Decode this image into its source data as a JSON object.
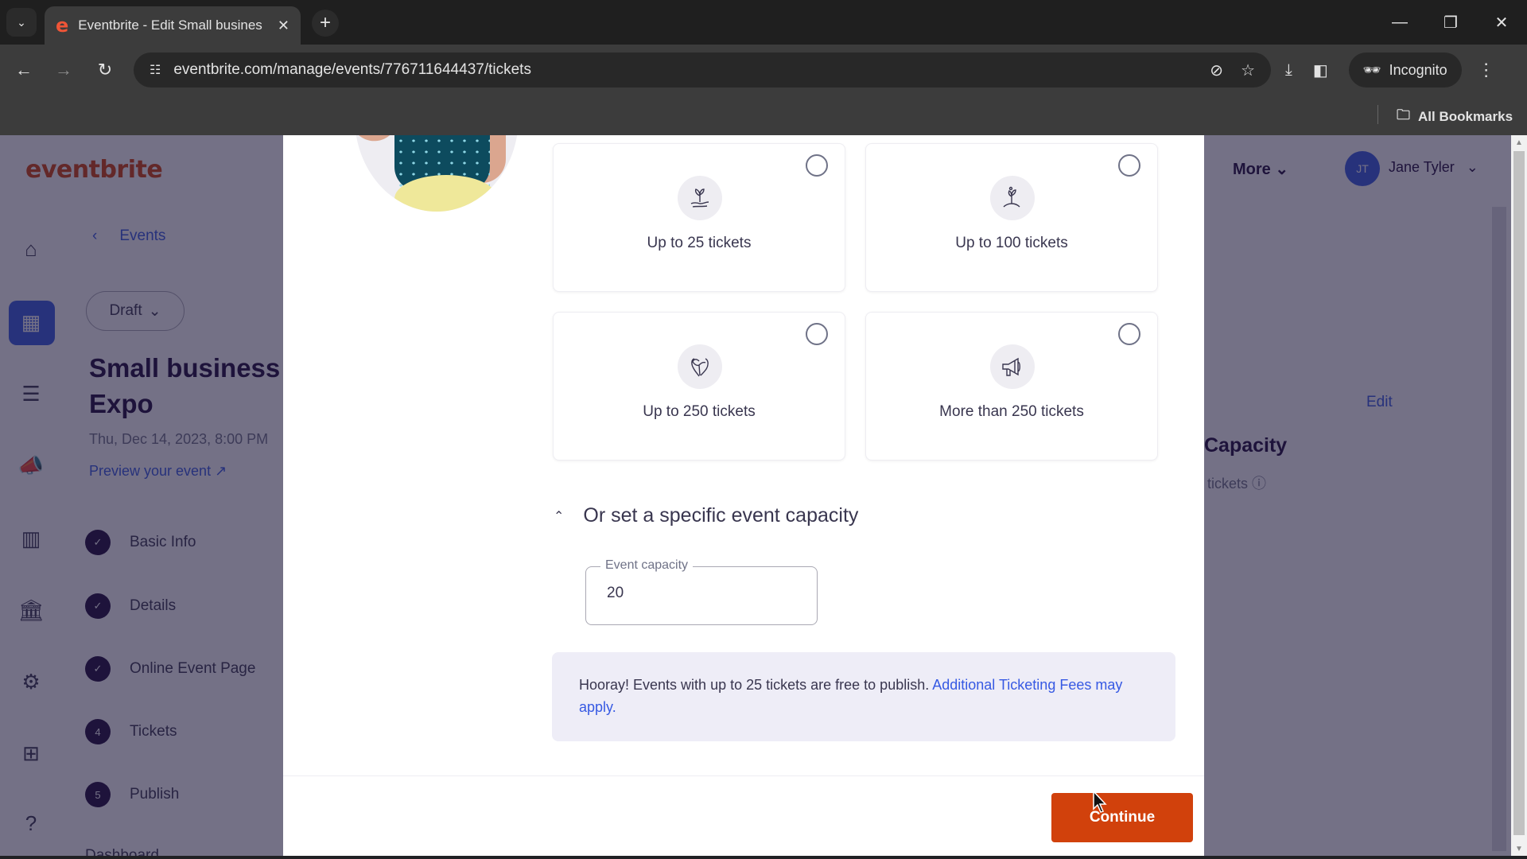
{
  "browser": {
    "tab_title": "Eventbrite - Edit Small busines",
    "favicon": "e",
    "url": "eventbrite.com/manage/events/776711644437/tickets",
    "incognito_label": "Incognito",
    "bookmarks_label": "All Bookmarks",
    "icons": {
      "tab_search": "chevron-down-icon",
      "tab_close": "close-icon",
      "new_tab": "plus-icon",
      "back": "arrow-left-icon",
      "forward": "arrow-right-icon",
      "reload": "reload-icon",
      "site_info": "tune-icon",
      "tracking": "eye-off-icon",
      "bookmark": "star-icon",
      "download": "download-icon",
      "side_panel": "side-panel-icon",
      "menu": "more-vert-icon"
    }
  },
  "page": {
    "logo": "eventbrite",
    "back_label": "Events",
    "status_button": "Draft",
    "event_title": "Small business Expo",
    "event_date": "Thu, Dec 14, 2023, 8:00 PM",
    "preview_link": "Preview your event",
    "steps": [
      {
        "label": "Basic Info",
        "state": "done",
        "marker": "✓"
      },
      {
        "label": "Details",
        "state": "done",
        "marker": "✓"
      },
      {
        "label": "Online Event Page",
        "state": "done",
        "marker": "✓"
      },
      {
        "label": "Tickets",
        "state": "current",
        "marker": "4"
      },
      {
        "label": "Publish",
        "state": "todo",
        "marker": "5"
      }
    ],
    "dashboard_label": "Dashboard",
    "top_nav_more": "More",
    "user_initials": "JT",
    "user_name": "Jane Tyler",
    "bg_edit_link": "Edit",
    "bg_capacity_heading": "Capacity",
    "bg_capacity_sub": "tickets"
  },
  "modal": {
    "options": [
      {
        "label": "Up to 25 tickets",
        "icon": "sprout-in-hand-icon",
        "selected": false
      },
      {
        "label": "Up to 100 tickets",
        "icon": "growing-plant-icon",
        "selected": false
      },
      {
        "label": "Up to 250 tickets",
        "icon": "heart-hands-icon",
        "selected": false
      },
      {
        "label": "More than 250 tickets",
        "icon": "megaphone-icon",
        "selected": false
      }
    ],
    "capacity_toggle_label": "Or set a specific event capacity",
    "capacity_field_label": "Event capacity",
    "capacity_value": "20",
    "notice_text": "Hooray! Events with up to 25 tickets are free to publish. ",
    "notice_link": "Additional Ticketing Fees may apply.",
    "continue_label": "Continue"
  },
  "colors": {
    "brand_orange": "#d1410c",
    "link_blue": "#3659e3",
    "text_dark": "#39364f"
  }
}
